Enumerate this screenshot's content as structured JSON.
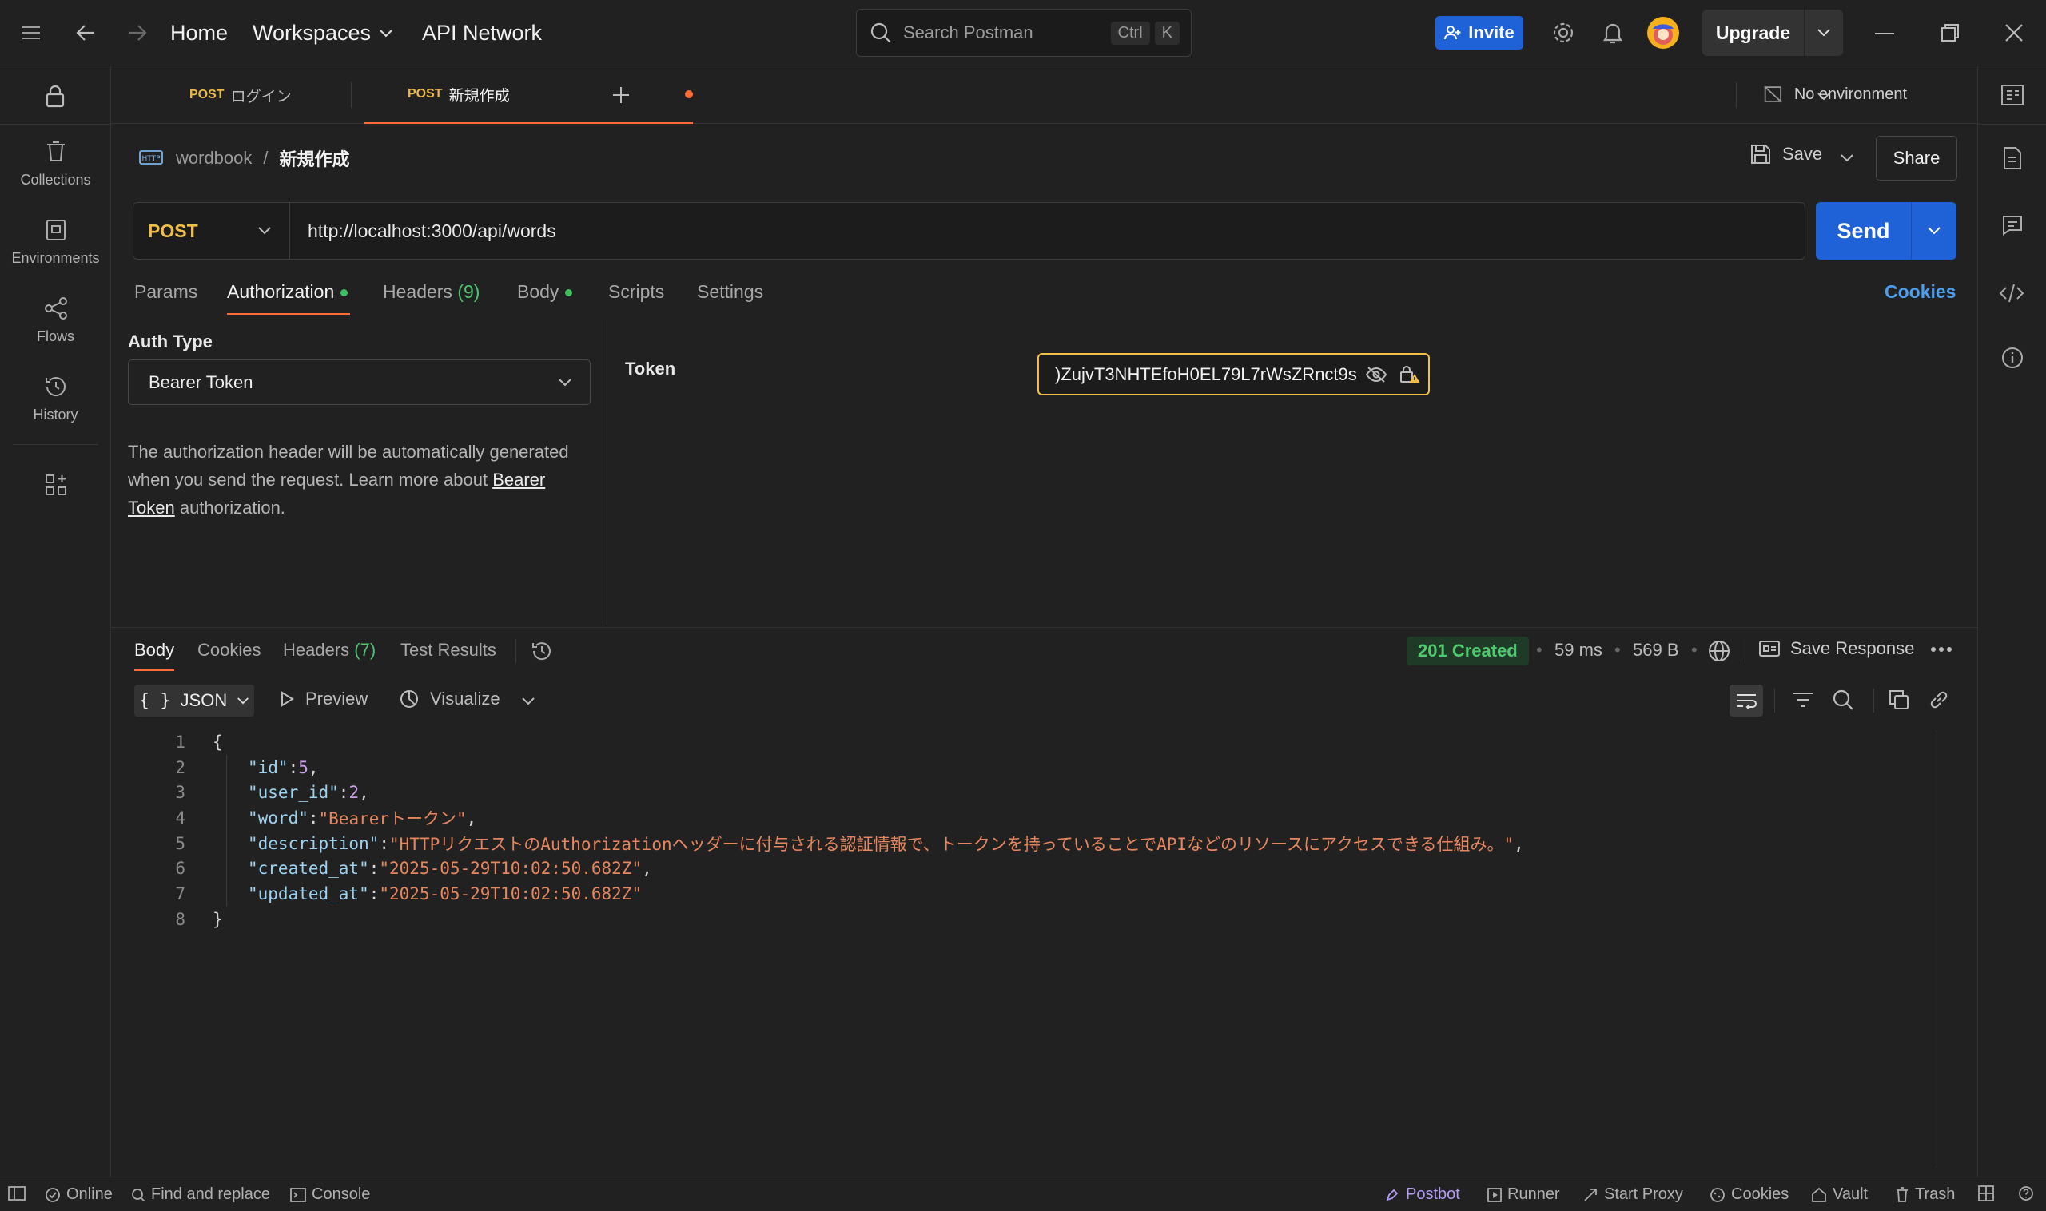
{
  "topbar": {
    "home": "Home",
    "workspaces": "Workspaces",
    "api_network": "API Network",
    "search_placeholder": "Search Postman",
    "search_kbd_ctrl": "Ctrl",
    "search_kbd_k": "K",
    "invite": "Invite",
    "upgrade": "Upgrade"
  },
  "sidebar": {
    "items": [
      {
        "label": "Collections",
        "icon": "collections-icon"
      },
      {
        "label": "Environments",
        "icon": "environments-icon"
      },
      {
        "label": "Flows",
        "icon": "flows-icon"
      },
      {
        "label": "History",
        "icon": "history-icon"
      }
    ]
  },
  "tabs": [
    {
      "method": "POST",
      "name": "ログイン"
    },
    {
      "method": "POST",
      "name": "新規作成",
      "active": true,
      "unsaved": true
    }
  ],
  "environment": "No environment",
  "breadcrumb": {
    "collection": "wordbook",
    "sep": "/",
    "request": "新規作成"
  },
  "actions": {
    "save": "Save",
    "share": "Share"
  },
  "request": {
    "method": "POST",
    "url": "http://localhost:3000/api/words",
    "send": "Send"
  },
  "request_tabs": {
    "params": "Params",
    "authorization": "Authorization",
    "headers": "Headers",
    "headers_count": "(9)",
    "body": "Body",
    "scripts": "Scripts",
    "settings": "Settings",
    "cookies": "Cookies"
  },
  "auth": {
    "type_label": "Auth Type",
    "type_value": "Bearer Token",
    "desc_1": "The authorization header will be automatically generated when you send the request. Learn more about ",
    "desc_link": "Bearer Token",
    "desc_2": " authorization.",
    "token_label": "Token",
    "token_value": ")ZujvT3NHTEfoH0EL79L7rWsZRnct9s"
  },
  "response_tabs": {
    "body": "Body",
    "cookies": "Cookies",
    "headers": "Headers",
    "headers_count": "(7)",
    "test_results": "Test Results"
  },
  "response_meta": {
    "status": "201 Created",
    "time": "59 ms",
    "size": "569 B",
    "save_response": "Save Response"
  },
  "format": {
    "json": "JSON",
    "preview": "Preview",
    "visualize": "Visualize"
  },
  "response_body": {
    "open": "{",
    "close": "}",
    "lines": [
      {
        "key": "\"id\"",
        "value": "5",
        "type": "num"
      },
      {
        "key": "\"user_id\"",
        "value": "2",
        "type": "num"
      },
      {
        "key": "\"word\"",
        "value": "\"Bearerトークン\"",
        "type": "str"
      },
      {
        "key": "\"description\"",
        "value": "\"HTTPリクエストのAuthorizationヘッダーに付与される認証情報で、トークンを持っていることでAPIなどのリソースにアクセスできる仕組み。\"",
        "type": "str"
      },
      {
        "key": "\"created_at\"",
        "value": "\"2025-05-29T10:02:50.682Z\"",
        "type": "str"
      },
      {
        "key": "\"updated_at\"",
        "value": "\"2025-05-29T10:02:50.682Z\"",
        "type": "str",
        "last": true
      }
    ],
    "line_numbers": [
      "1",
      "2",
      "3",
      "4",
      "5",
      "6",
      "7",
      "8"
    ]
  },
  "footer": {
    "online": "Online",
    "find_replace": "Find and replace",
    "console": "Console",
    "postbot": "Postbot",
    "runner": "Runner",
    "start_proxy": "Start Proxy",
    "cookies": "Cookies",
    "vault": "Vault",
    "trash": "Trash"
  },
  "colors": {
    "accent_blue": "#1f61d6",
    "post_method": "#f0bf46",
    "active_tab_underline": "#ff6c37",
    "status_green": "#51c96f",
    "postbot_purple": "#b39cf5"
  }
}
